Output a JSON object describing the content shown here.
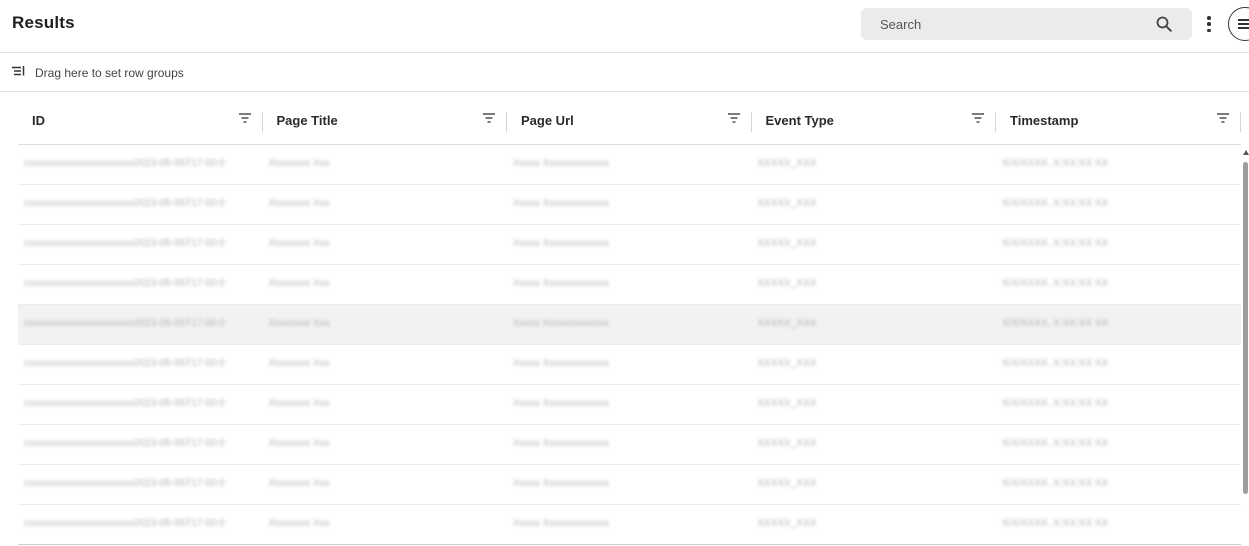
{
  "header": {
    "title": "Results",
    "search_placeholder": "Search"
  },
  "group_bar": {
    "label": "Drag here to set row groups"
  },
  "grid": {
    "columns": [
      "ID",
      "Page Title",
      "Page Url",
      "Event Type",
      "Timestamp"
    ],
    "highlighted_row": 5,
    "rows": [
      [
        "cxxxxxxxxxxxxxxxxxxxxx2023-05-05T17:00:0",
        "Xxxxxxxx Xxx",
        "Xxxxx Xxxxxxxxxxxxx",
        "XXXXX_XXX",
        "X/X/XXXX, X:XX:XX XX"
      ],
      [
        "cxxxxxxxxxxxxxxxxxxxxx2023-05-05T17:00:0",
        "Xxxxxxxx Xxx",
        "Xxxxx Xxxxxxxxxxxxx",
        "XXXXX_XXX",
        "X/X/XXXX, X:XX:XX XX"
      ],
      [
        "cxxxxxxxxxxxxxxxxxxxxx2023-05-05T17:00:0",
        "Xxxxxxxx Xxx",
        "Xxxxx Xxxxxxxxxxxxx",
        "XXXXX_XXX",
        "X/X/XXXX, X:XX:XX XX"
      ],
      [
        "cxxxxxxxxxxxxxxxxxxxxx2023-05-05T17:00:0",
        "Xxxxxxxx Xxx",
        "Xxxxx Xxxxxxxxxxxxx",
        "XXXXX_XXX",
        "X/X/XXXX, X:XX:XX XX"
      ],
      [
        "cxxxxxxxxxxxxxxxxxxxxx2023-05-05T17:00:0",
        "Xxxxxxxx Xxx",
        "Xxxxx Xxxxxxxxxxxxx",
        "XXXXX_XXX",
        "X/X/XXXX, X:XX:XX XX"
      ],
      [
        "cxxxxxxxxxxxxxxxxxxxxx2023-05-05T17:00:0",
        "Xxxxxxxx Xxx",
        "Xxxxx Xxxxxxxxxxxxx",
        "XXXXX_XXX",
        "X/X/XXXX, X:XX:XX XX"
      ],
      [
        "cxxxxxxxxxxxxxxxxxxxxx2023-05-05T17:00:0",
        "Xxxxxxxx Xxx",
        "Xxxxx Xxxxxxxxxxxxx",
        "XXXXX_XXX",
        "X/X/XXXX, X:XX:XX XX"
      ],
      [
        "cxxxxxxxxxxxxxxxxxxxxx2023-05-05T17:00:0",
        "Xxxxxxxx Xxx",
        "Xxxxx Xxxxxxxxxxxxx",
        "XXXXX_XXX",
        "X/X/XXXX, X:XX:XX XX"
      ],
      [
        "cxxxxxxxxxxxxxxxxxxxxx2023-05-05T17:00:0",
        "Xxxxxxxx Xxx",
        "Xxxxx Xxxxxxxxxxxxx",
        "XXXXX_XXX",
        "X/X/XXXX, X:XX:XX XX"
      ],
      [
        "cxxxxxxxxxxxxxxxxxxxxx2023-05-05T17:00:0",
        "Xxxxxxxx Xxx",
        "Xxxxx Xxxxxxxxxxxxx",
        "XXXXX_XXX",
        "X/X/XXXX, X:XX:XX XX"
      ]
    ]
  },
  "icons": {
    "search": "search-icon",
    "more": "more-vertical-icon",
    "menu": "menu-icon",
    "row_groups": "row-groups-icon",
    "filter": "filter-icon"
  }
}
